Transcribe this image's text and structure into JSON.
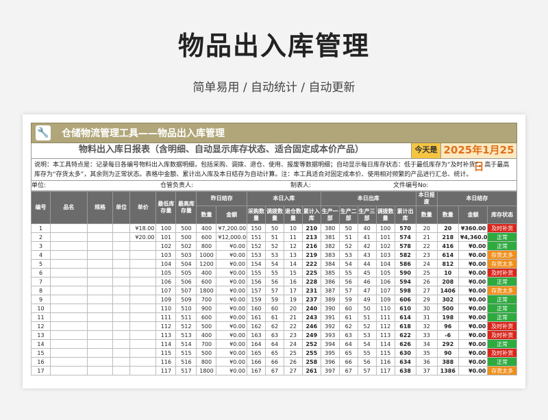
{
  "page": {
    "title": "物品出入库管理",
    "subtitle": "简单易用  /  自动统计  /  自动更新"
  },
  "sheet": {
    "tool_title": "仓储物流管理工具——物品出入库管理",
    "report_title": "物料出入库日报表（含明细、自动显示库存状态、适合固定成本价产品）",
    "today_label": "今天是",
    "today_value": "2025年1月25日",
    "description": "说明：本工具特点是：记录每日各编号物料出入库数据明细，包括采购、调拨、退仓、使用、报废等数据明细；自动显示每日库存状态：低于最低库存为“及时补货”，高于最高库存为“存货太多”，其余则为正常状态。表格中金额、累计出入库及本日结存为自动计算。注：本工具适合对固定成本价、使用相对频繁的产品进行汇总、统计。",
    "meta": {
      "unit": "单位:",
      "manager": "仓管负责人:",
      "preparer": "制表人:",
      "doc_no": "文件编号No:"
    },
    "headers": {
      "no": "编号",
      "name": "品名",
      "spec": "规格",
      "unit": "单位",
      "price": "单价",
      "min_stock": "最低库存量",
      "max_stock": "最高库存量",
      "yesterday": "昨日结存",
      "qty": "数量",
      "amount": "金额",
      "today_in": "本日入库",
      "purchase": "采购数量",
      "transfer_in": "调拨数量",
      "return": "退仓数量",
      "cum_in": "累计入库",
      "today_out": "本日出库",
      "prod1": "生产一部",
      "prod2": "生产二部",
      "prod3": "生产三部",
      "transfer_out": "调拨数量",
      "cum_out": "累计出库",
      "scrap": "本日报废",
      "scrap_qty": "数量",
      "today_stock": "本日结存",
      "stock_qty": "数量",
      "stock_amount": "金额",
      "status": "库存状态"
    },
    "rows": [
      [
        "1",
        "",
        "",
        "",
        "¥18.00",
        "100",
        "500",
        "400",
        "¥7,200.00",
        "150",
        "50",
        "10",
        "210",
        "380",
        "50",
        "40",
        "100",
        "570",
        "20",
        "20",
        "¥360.00",
        "及时补货"
      ],
      [
        "2",
        "",
        "",
        "",
        "¥20.00",
        "101",
        "500",
        "600",
        "¥12,000.00",
        "151",
        "51",
        "11",
        "213",
        "381",
        "51",
        "41",
        "101",
        "574",
        "21",
        "218",
        "¥4,360.00",
        "正常"
      ],
      [
        "3",
        "",
        "",
        "",
        "",
        "102",
        "502",
        "800",
        "¥0.00",
        "152",
        "52",
        "12",
        "216",
        "382",
        "52",
        "42",
        "102",
        "578",
        "22",
        "416",
        "¥0.00",
        "正常"
      ],
      [
        "4",
        "",
        "",
        "",
        "",
        "103",
        "503",
        "1000",
        "¥0.00",
        "153",
        "53",
        "13",
        "219",
        "383",
        "53",
        "43",
        "103",
        "582",
        "23",
        "614",
        "¥0.00",
        "存货太多"
      ],
      [
        "5",
        "",
        "",
        "",
        "",
        "104",
        "504",
        "1200",
        "¥0.00",
        "154",
        "54",
        "14",
        "222",
        "384",
        "54",
        "44",
        "104",
        "586",
        "24",
        "812",
        "¥0.00",
        "存货太多"
      ],
      [
        "6",
        "",
        "",
        "",
        "",
        "105",
        "505",
        "400",
        "¥0.00",
        "155",
        "55",
        "15",
        "225",
        "385",
        "55",
        "45",
        "105",
        "590",
        "25",
        "10",
        "¥0.00",
        "及时补货"
      ],
      [
        "7",
        "",
        "",
        "",
        "",
        "106",
        "506",
        "600",
        "¥0.00",
        "156",
        "56",
        "16",
        "228",
        "386",
        "56",
        "46",
        "106",
        "594",
        "26",
        "208",
        "¥0.00",
        "正常"
      ],
      [
        "8",
        "",
        "",
        "",
        "",
        "107",
        "507",
        "1800",
        "¥0.00",
        "157",
        "57",
        "17",
        "231",
        "387",
        "57",
        "47",
        "107",
        "598",
        "27",
        "1406",
        "¥0.00",
        "存货太多"
      ],
      [
        "9",
        "",
        "",
        "",
        "",
        "109",
        "509",
        "700",
        "¥0.00",
        "159",
        "59",
        "19",
        "237",
        "389",
        "59",
        "49",
        "109",
        "606",
        "29",
        "302",
        "¥0.00",
        "正常"
      ],
      [
        "10",
        "",
        "",
        "",
        "",
        "110",
        "510",
        "900",
        "¥0.00",
        "160",
        "60",
        "20",
        "240",
        "390",
        "60",
        "50",
        "110",
        "610",
        "30",
        "500",
        "¥0.00",
        "正常"
      ],
      [
        "11",
        "",
        "",
        "",
        "",
        "111",
        "511",
        "600",
        "¥0.00",
        "161",
        "61",
        "21",
        "243",
        "391",
        "61",
        "51",
        "111",
        "614",
        "31",
        "198",
        "¥0.00",
        "正常"
      ],
      [
        "12",
        "",
        "",
        "",
        "",
        "112",
        "512",
        "500",
        "¥0.00",
        "162",
        "62",
        "22",
        "246",
        "392",
        "62",
        "52",
        "112",
        "618",
        "32",
        "96",
        "¥0.00",
        "及时补货"
      ],
      [
        "13",
        "",
        "",
        "",
        "",
        "113",
        "513",
        "400",
        "¥0.00",
        "163",
        "63",
        "23",
        "249",
        "393",
        "63",
        "53",
        "113",
        "622",
        "33",
        "-6",
        "¥0.00",
        "及时补货"
      ],
      [
        "14",
        "",
        "",
        "",
        "",
        "114",
        "514",
        "700",
        "¥0.00",
        "164",
        "64",
        "24",
        "252",
        "394",
        "64",
        "54",
        "114",
        "626",
        "34",
        "292",
        "¥0.00",
        "正常"
      ],
      [
        "15",
        "",
        "",
        "",
        "",
        "115",
        "515",
        "500",
        "¥0.00",
        "165",
        "65",
        "25",
        "255",
        "395",
        "65",
        "55",
        "115",
        "630",
        "35",
        "90",
        "¥0.00",
        "及时补货"
      ],
      [
        "16",
        "",
        "",
        "",
        "",
        "116",
        "516",
        "800",
        "¥0.00",
        "166",
        "66",
        "26",
        "258",
        "396",
        "66",
        "56",
        "116",
        "634",
        "36",
        "388",
        "¥0.00",
        "正常"
      ],
      [
        "17",
        "",
        "",
        "",
        "",
        "117",
        "517",
        "1800",
        "¥0.00",
        "167",
        "67",
        "27",
        "261",
        "397",
        "67",
        "57",
        "117",
        "638",
        "37",
        "1386",
        "¥0.00",
        "存货太多"
      ]
    ],
    "status_colors": {
      "正常": "#2eaa3f",
      "及时补货": "#d9261c",
      "存货太多": "#ef8f1c"
    }
  }
}
